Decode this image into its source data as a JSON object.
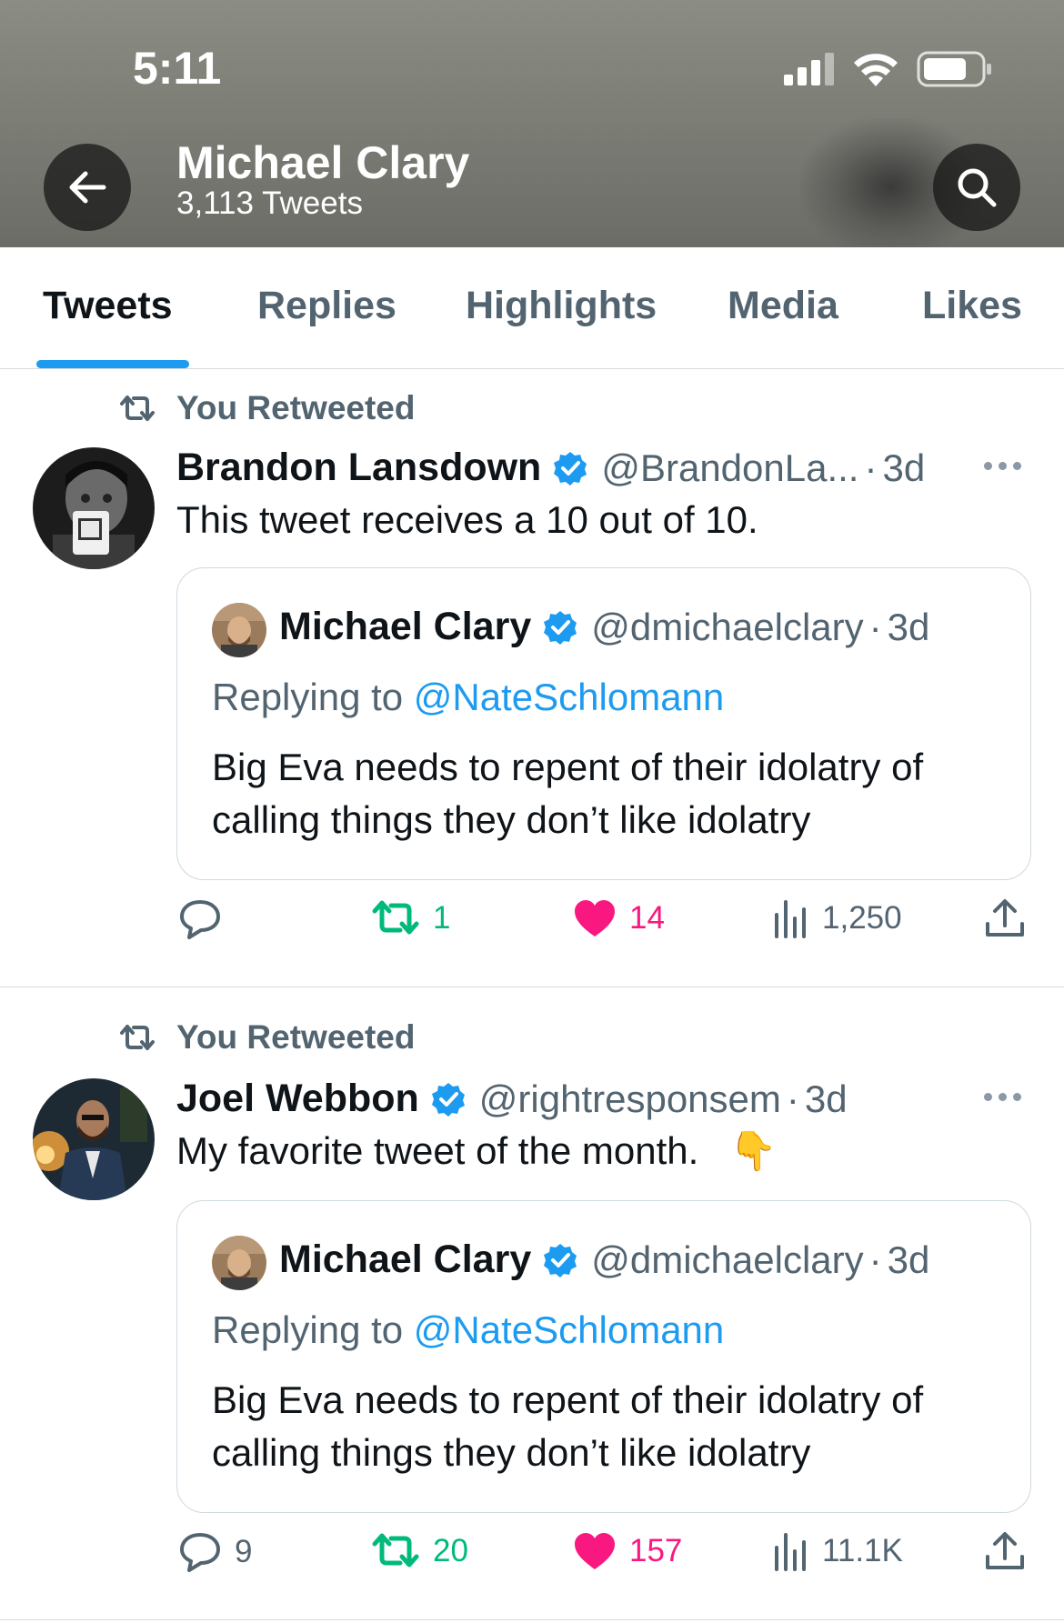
{
  "status_bar": {
    "time": "5:11"
  },
  "header": {
    "name": "Michael Clary",
    "tweet_count": "3,113 Tweets"
  },
  "tabs": [
    {
      "label": "Tweets",
      "active": true
    },
    {
      "label": "Replies",
      "active": false
    },
    {
      "label": "Highlights",
      "active": false
    },
    {
      "label": "Media",
      "active": false
    },
    {
      "label": "Likes",
      "active": false
    }
  ],
  "tweets": [
    {
      "retweet_label": "You Retweeted",
      "author": "Brandon Lansdown",
      "handle": "@BrandonLa...",
      "dot": "·",
      "time": "3d",
      "text": "This tweet receives a 10 out of 10.",
      "quote": {
        "author": "Michael Clary",
        "handle": "@dmichaelclary",
        "dot": "·",
        "time": "3d",
        "replying_prefix": "Replying to",
        "replying_to": "@NateSchlomann",
        "text": "Big Eva needs to repent of their idolatry of calling things they don’t like idolatry"
      },
      "stats": {
        "replies": "",
        "retweets": "1",
        "likes": "14",
        "views": "1,250"
      }
    },
    {
      "retweet_label": "You Retweeted",
      "author": "Joel Webbon",
      "handle": "@rightresponsem",
      "dot": "·",
      "time": "3d",
      "text": "My favorite tweet of the month.",
      "emoji": "👇",
      "quote": {
        "author": "Michael Clary",
        "handle": "@dmichaelclary",
        "dot": "·",
        "time": "3d",
        "replying_prefix": "Replying to",
        "replying_to": "@NateSchlomann",
        "text": "Big Eva needs to repent of their idolatry of calling things they don’t like idolatry"
      },
      "stats": {
        "replies": "9",
        "retweets": "20",
        "likes": "157",
        "views": "11.1K"
      }
    }
  ],
  "colors": {
    "accent": "#1d9bf0",
    "retweet_green": "#00ba7c",
    "like_pink": "#f91880",
    "muted": "#536471"
  }
}
